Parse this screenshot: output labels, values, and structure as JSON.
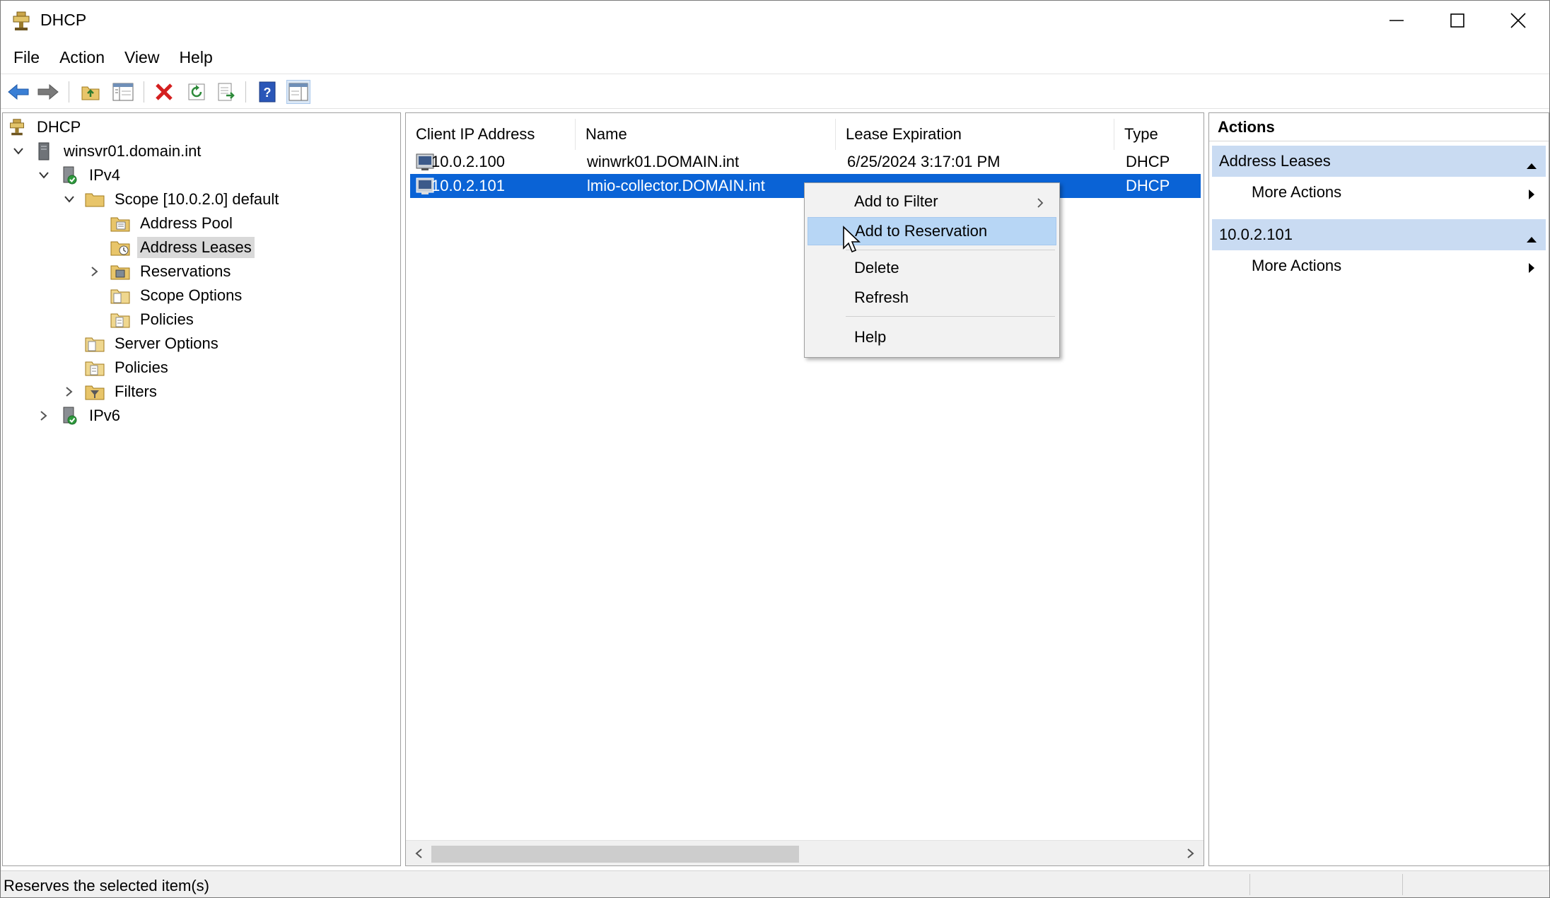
{
  "window": {
    "title": "DHCP",
    "controls": {
      "minimize": "minimize",
      "maximize": "maximize",
      "close": "close"
    }
  },
  "menubar": {
    "items": [
      "File",
      "Action",
      "View",
      "Help"
    ]
  },
  "toolbar": {
    "buttons": [
      "back-arrow-icon",
      "forward-arrow-icon",
      "up-folder-icon",
      "show-tree-icon",
      "delete-icon",
      "refresh-icon",
      "export-icon",
      "help-icon",
      "show-actions-icon"
    ]
  },
  "tree": {
    "root": "DHCP",
    "server": "winsvr01.domain.int",
    "ipv4": "IPv4",
    "scope": "Scope [10.0.2.0] default",
    "address_pool": "Address Pool",
    "address_leases": "Address Leases",
    "reservations": "Reservations",
    "scope_options": "Scope Options",
    "scope_policies": "Policies",
    "server_options": "Server Options",
    "policies": "Policies",
    "filters": "Filters",
    "ipv6": "IPv6"
  },
  "list": {
    "columns": [
      "Client IP Address",
      "Name",
      "Lease Expiration",
      "Type"
    ],
    "rows": [
      {
        "ip": "10.0.2.100",
        "name": "winwrk01.DOMAIN.int",
        "lease": "6/25/2024 3:17:01 PM",
        "type": "DHCP"
      },
      {
        "ip": "10.0.2.101",
        "name": "lmio-collector.DOMAIN.int",
        "lease": "",
        "type": "DHCP"
      }
    ]
  },
  "actions": {
    "title": "Actions",
    "section1": "Address Leases",
    "section1_more": "More Actions",
    "section2": "10.0.2.101",
    "section2_more": "More Actions"
  },
  "context_menu": {
    "add_to_filter": "Add to Filter",
    "add_to_reservation": "Add to Reservation",
    "delete": "Delete",
    "refresh": "Refresh",
    "help": "Help"
  },
  "status": {
    "text": "Reserves the selected item(s)"
  },
  "colors": {
    "selection": "#0a63d6",
    "menu_hover": "#b7d6f5",
    "action_section": "#c9dbf2"
  }
}
